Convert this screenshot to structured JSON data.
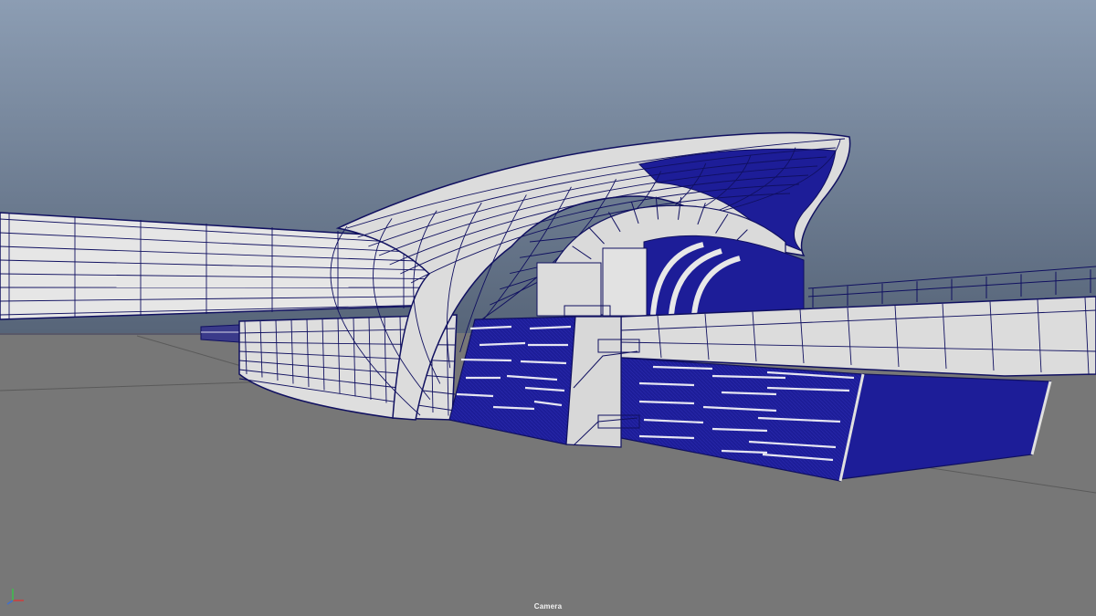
{
  "viewport": {
    "camera_label": "Camera",
    "sky_top_color": "#8d9db3",
    "sky_bottom_color": "#556377",
    "ground_color": "#777777",
    "wire_color": "#101060",
    "shaded_color": "#1a1a96",
    "surface_color": "#e4e4e4"
  },
  "gizmo": {
    "axes": [
      "x-axis",
      "y-axis",
      "z-axis"
    ],
    "colors": {
      "x": "#d23b3b",
      "y": "#3bc14a",
      "z": "#3b6fd2"
    }
  }
}
